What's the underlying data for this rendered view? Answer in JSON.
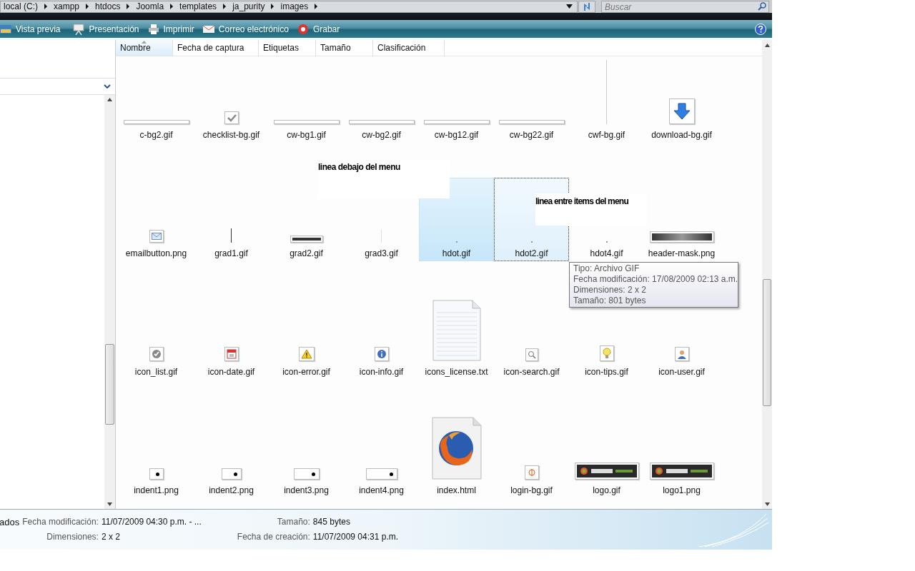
{
  "address_bar": {
    "crumbs": [
      "local (C:)",
      "xampp",
      "htdocs",
      "Joomla",
      "templates",
      "ja_purity",
      "images"
    ]
  },
  "search": {
    "placeholder": "Buscar"
  },
  "toolbar": {
    "items": [
      {
        "label": "Vista previa",
        "kind": "preview"
      },
      {
        "label": "Presentación",
        "kind": "slideshow"
      },
      {
        "label": "Imprimir",
        "kind": "print"
      },
      {
        "label": "Correo electrónico",
        "kind": "mail"
      },
      {
        "label": "Grabar",
        "kind": "burn"
      }
    ]
  },
  "columns": [
    {
      "label": "Nombre",
      "selected": true
    },
    {
      "label": "Fecha de captura",
      "selected": false
    },
    {
      "label": "Etiquetas",
      "selected": false
    },
    {
      "label": "Tamaño",
      "selected": false
    },
    {
      "label": "Clasificación",
      "selected": false
    }
  ],
  "files": [
    {
      "name": "c-bg2.gif",
      "kind": "bar",
      "selected": false,
      "focused": false
    },
    {
      "name": "checklist-bg.gif",
      "kind": "check",
      "selected": false,
      "focused": false
    },
    {
      "name": "cw-bg1.gif",
      "kind": "bar",
      "selected": false,
      "focused": false
    },
    {
      "name": "cw-bg2.gif",
      "kind": "bar",
      "selected": false,
      "focused": false
    },
    {
      "name": "cw-bg12.gif",
      "kind": "bar",
      "selected": false,
      "focused": false
    },
    {
      "name": "cw-bg22.gif",
      "kind": "bar",
      "selected": false,
      "focused": false
    },
    {
      "name": "cwf-bg.gif",
      "kind": "tall-line",
      "selected": false,
      "focused": false
    },
    {
      "name": "download-bg.gif",
      "kind": "download",
      "selected": false,
      "focused": false
    },
    {
      "name": "emailbutton.png",
      "kind": "mail",
      "selected": false,
      "focused": false
    },
    {
      "name": "grad1.gif",
      "kind": "vline",
      "selected": false,
      "focused": false
    },
    {
      "name": "grad2.gif",
      "kind": "thick",
      "selected": false,
      "focused": false
    },
    {
      "name": "grad3.gif",
      "kind": "faint-line",
      "selected": false,
      "focused": false
    },
    {
      "name": "hdot.gif",
      "kind": "dot",
      "selected": true,
      "focused": false
    },
    {
      "name": "hdot2.gif",
      "kind": "dot",
      "selected": true,
      "focused": true
    },
    {
      "name": "hdot4.gif",
      "kind": "dot",
      "selected": false,
      "focused": false
    },
    {
      "name": "header-mask.png",
      "kind": "gradient",
      "selected": false,
      "focused": false
    },
    {
      "name": "icon_list.gif",
      "kind": "check-circle",
      "selected": false,
      "focused": false
    },
    {
      "name": "icon-date.gif",
      "kind": "calendar",
      "selected": false,
      "focused": false
    },
    {
      "name": "icon-error.gif",
      "kind": "warning",
      "selected": false,
      "focused": false
    },
    {
      "name": "icon-info.gif",
      "kind": "info",
      "selected": false,
      "focused": false
    },
    {
      "name": "icons_license.txt",
      "kind": "document",
      "selected": false,
      "focused": false
    },
    {
      "name": "icon-search.gif",
      "kind": "magnifier",
      "selected": false,
      "focused": false
    },
    {
      "name": "icon-tips.gif",
      "kind": "bulb",
      "selected": false,
      "focused": false
    },
    {
      "name": "icon-user.gif",
      "kind": "user",
      "selected": false,
      "focused": false
    },
    {
      "name": "indent1.png",
      "kind": "indent1",
      "selected": false,
      "focused": false
    },
    {
      "name": "indent2.png",
      "kind": "indent2",
      "selected": false,
      "focused": false
    },
    {
      "name": "indent3.png",
      "kind": "indent3",
      "selected": false,
      "focused": false
    },
    {
      "name": "indent4.png",
      "kind": "indent4",
      "selected": false,
      "focused": false
    },
    {
      "name": "index.html",
      "kind": "browser-file",
      "selected": false,
      "focused": false
    },
    {
      "name": "login-bg.gif",
      "kind": "login",
      "selected": false,
      "focused": false
    },
    {
      "name": "logo.gif",
      "kind": "logo",
      "selected": false,
      "focused": false
    },
    {
      "name": "logo1.png",
      "kind": "logo",
      "selected": false,
      "focused": false
    }
  ],
  "annotations": [
    {
      "text": "linea debajo del menu"
    },
    {
      "text": "linea entre items del menu"
    }
  ],
  "tooltip": {
    "lines": [
      "Tipo: Archivo GIF",
      "Fecha modificación: 17/08/2009 02:13 a.m.",
      "Dimensiones: 2 x 2",
      "Tamaño: 801 bytes"
    ]
  },
  "details": {
    "cut_text": "ados",
    "fields": [
      {
        "label": "Fecha modificación:",
        "value": "11/07/2009 04:30 p.m. - ..."
      },
      {
        "label": "Tamaño:",
        "value": "845 bytes"
      },
      {
        "label": "Dimensiones:",
        "value": "2 x 2"
      },
      {
        "label": "Fecha de creación:",
        "value": "11/07/2009 04:31 p.m."
      }
    ]
  }
}
